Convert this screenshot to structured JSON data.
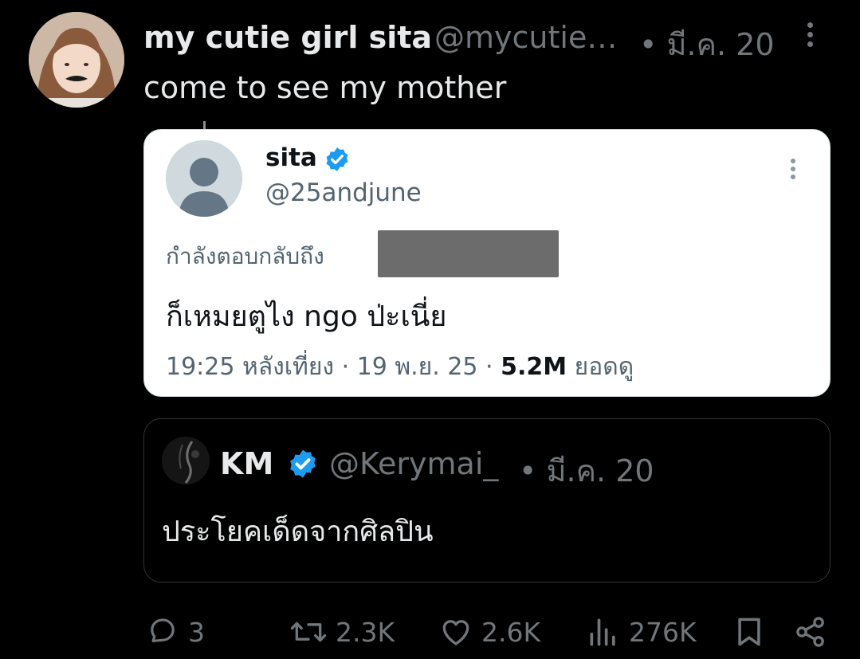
{
  "post": {
    "display_name": "my cutie girl sita",
    "handle": "@mycutie…",
    "date": "• มี.ค. 20",
    "text": "come to see my mother"
  },
  "embedded_screenshot": {
    "display_name": "sita",
    "handle": "@25andjune",
    "reply_label": "กำลังตอบกลับถึง",
    "text": "ก็เหมยตูไง ngo ป่ะเนี่ย",
    "meta_prefix": "19:25 หลังเที่ยง · 19 พ.ย. 25 · ",
    "views": "5.2M",
    "views_suffix": " ยอดดู"
  },
  "quoted_post": {
    "display_name": "KM",
    "handle": "@Kerymai_",
    "date": "• มี.ค. 20",
    "text": "ประโยคเด็ดจากศิลปิน"
  },
  "actions": {
    "replies": "3",
    "reposts": "2.3K",
    "likes": "2.6K",
    "views": "276K"
  },
  "colors": {
    "background": "#000000",
    "primary_text": "#e7e9ea",
    "secondary_text": "#71767b",
    "verified_blue": "#1d9bf0",
    "card_white": "#ffffff"
  },
  "icons": [
    "more-vertical-icon",
    "verified-badge-icon",
    "reply-icon",
    "retweet-icon",
    "heart-icon",
    "views-icon",
    "bookmark-icon",
    "share-icon"
  ]
}
